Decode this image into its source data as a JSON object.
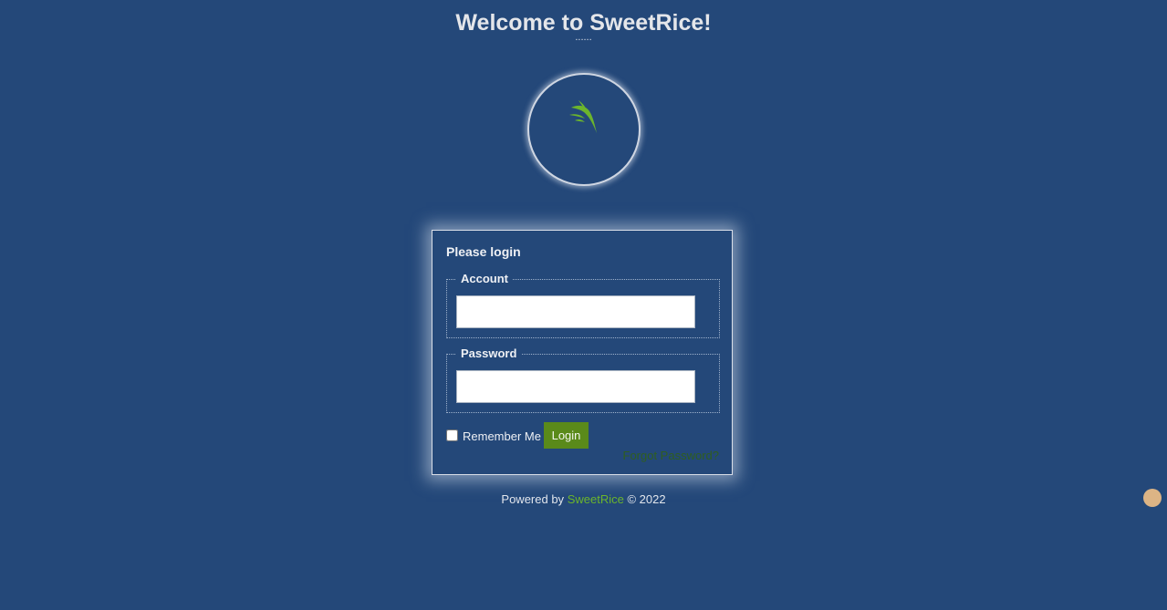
{
  "header": {
    "title": "Welcome to SweetRice!",
    "subtitle": "......"
  },
  "logo": {
    "icon": "rice-leaf-icon",
    "color": "#6cb52c"
  },
  "login": {
    "heading": "Please login",
    "account_label": "Account",
    "account_value": "",
    "password_label": "Password",
    "password_value": "",
    "remember_label": "Remember Me",
    "remember_checked": false,
    "login_button": "Login",
    "forgot_link": "Forgot Password?"
  },
  "footer": {
    "powered_by": "Powered by",
    "brand": "SweetRice",
    "copyright": "© 2022"
  },
  "colors": {
    "background": "#244879",
    "accent_green": "#5a8a1a",
    "brand_green": "#6cb52c",
    "floating_dot": "#dcb485"
  }
}
